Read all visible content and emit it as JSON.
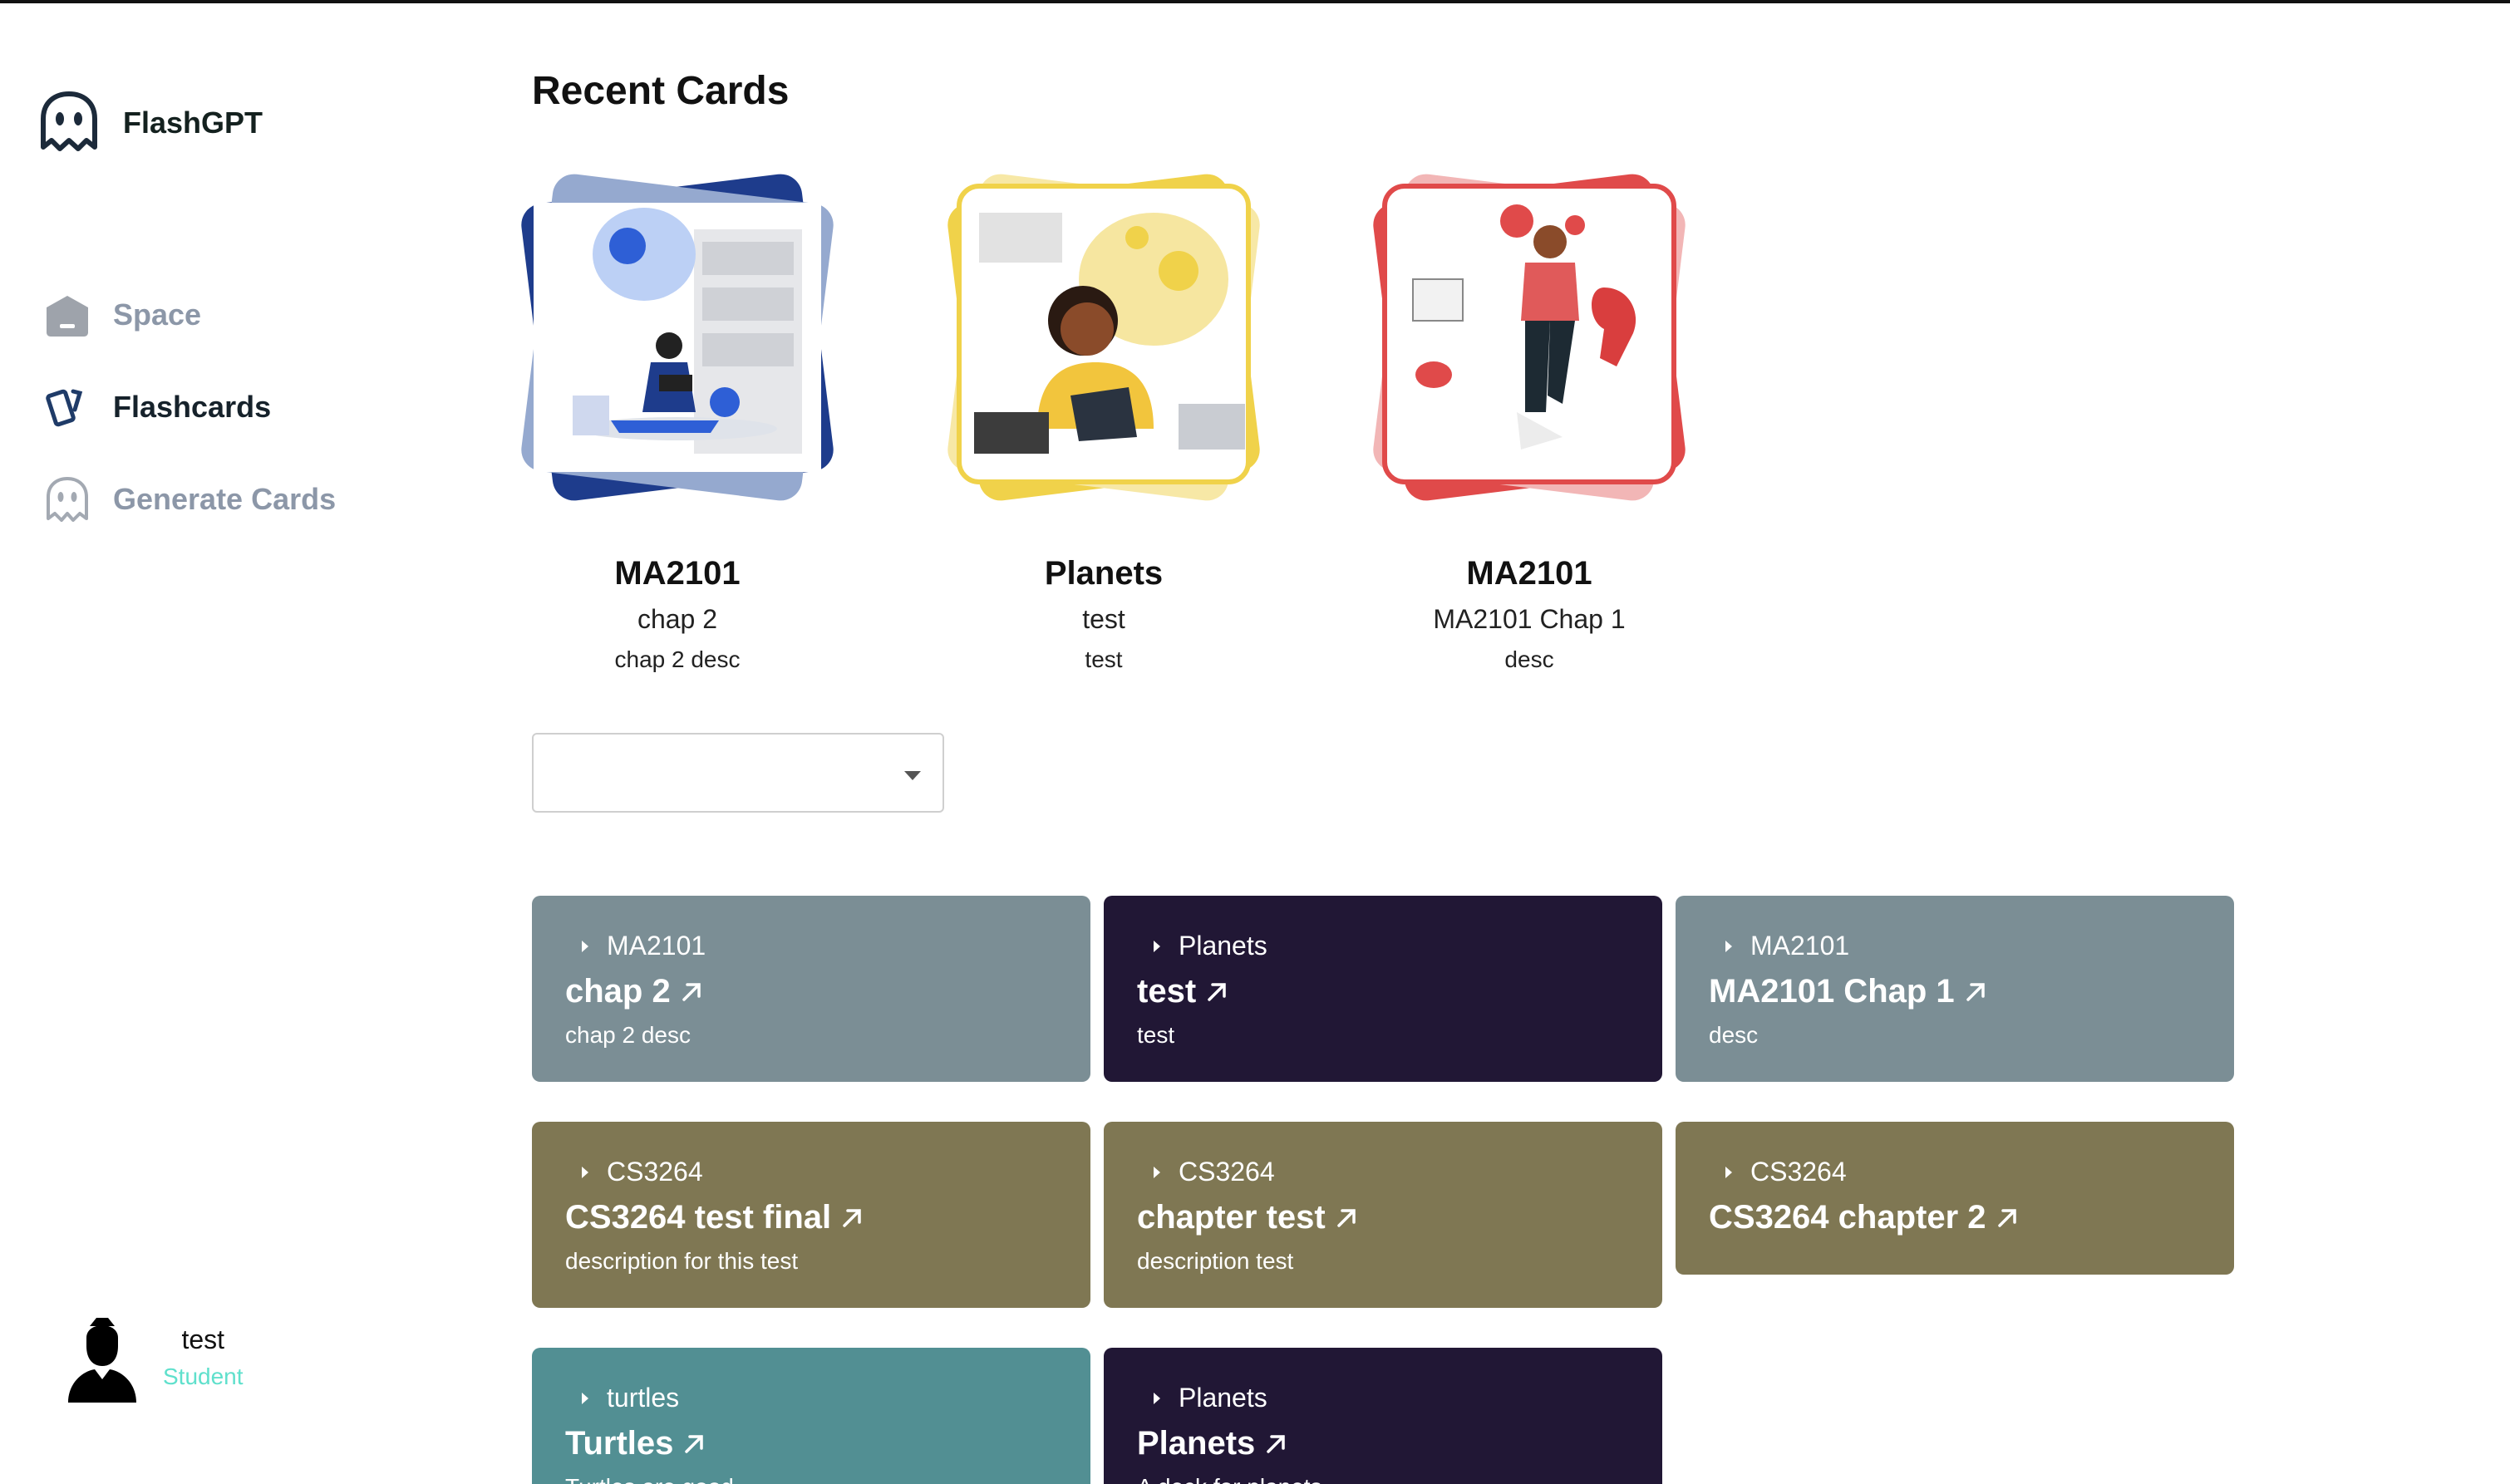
{
  "app": {
    "name": "FlashGPT"
  },
  "colors": {
    "slate": "#7b8e95",
    "navy": "#211735",
    "olive": "#7f7753",
    "teal": "#528f93",
    "accent": "#5fe0cc"
  },
  "sidebar": {
    "items": [
      {
        "label": "Space",
        "icon": "home-icon",
        "active": false
      },
      {
        "label": "Flashcards",
        "icon": "cards-icon",
        "active": true
      },
      {
        "label": "Generate Cards",
        "icon": "ghost-icon",
        "active": false
      }
    ]
  },
  "profile": {
    "name": "test",
    "role": "Student",
    "icon": "user-avatar-icon"
  },
  "main": {
    "title": "Recent Cards",
    "recent": [
      {
        "title": "MA2101",
        "subtitle": "chap 2",
        "description": "chap 2 desc",
        "theme": "#1e3c8c"
      },
      {
        "title": "Planets",
        "subtitle": "test",
        "description": "test",
        "theme": "#f0d24a"
      },
      {
        "title": "MA2101",
        "subtitle": "MA2101 Chap 1",
        "description": "desc",
        "theme": "#e04a4a"
      }
    ],
    "filter_value": "",
    "decks": [
      {
        "space": "MA2101",
        "name": "chap 2",
        "description": "chap 2 desc",
        "color": "#7b8e95"
      },
      {
        "space": "Planets",
        "name": "test",
        "description": "test",
        "color": "#211735"
      },
      {
        "space": "MA2101",
        "name": "MA2101 Chap 1",
        "description": "desc",
        "color": "#7b8e95"
      },
      {
        "space": "CS3264",
        "name": "CS3264 test final",
        "description": "description for this test",
        "color": "#7f7753"
      },
      {
        "space": "CS3264",
        "name": "chapter test",
        "description": "description test",
        "color": "#7f7753"
      },
      {
        "space": "CS3264",
        "name": "CS3264 chapter 2",
        "description": "",
        "color": "#7f7753"
      },
      {
        "space": "turtles",
        "name": "Turtles",
        "description": "Turtles are good",
        "color": "#528f93"
      },
      {
        "space": "Planets",
        "name": "Planets",
        "description": "A deck for planets",
        "color": "#211735"
      }
    ]
  }
}
